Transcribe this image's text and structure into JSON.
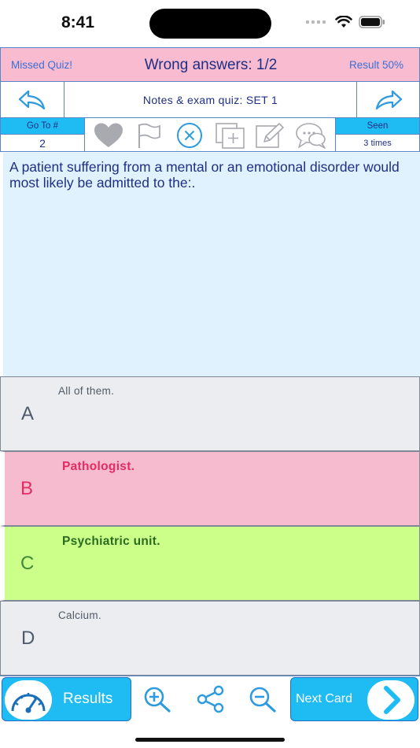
{
  "status_bar": {
    "time": "8:41"
  },
  "header": {
    "missed_quiz": "Missed Quiz!",
    "wrong_answers": "Wrong answers: 1/2",
    "result": "Result 50%"
  },
  "nav": {
    "title": "Notes & exam quiz: SET 1"
  },
  "tools": {
    "goto_label": "Go To #",
    "goto_value": "2",
    "seen_label": "Seen",
    "seen_value": "3 times",
    "icons": [
      "heart-icon",
      "flag-icon",
      "close-circle-icon",
      "add-copy-icon",
      "edit-icon",
      "chat-icon"
    ]
  },
  "question": {
    "text": "A patient suffering from a mental or an emotional disorder would most likely be admitted to the:."
  },
  "answers": [
    {
      "letter": "A",
      "text": "All of them.",
      "state": "neutral"
    },
    {
      "letter": "B",
      "text": "Pathologist.",
      "state": "wrong"
    },
    {
      "letter": "C",
      "text": "Psychiatric unit.",
      "state": "correct"
    },
    {
      "letter": "D",
      "text": "Calcium.",
      "state": "neutral"
    }
  ],
  "bottom": {
    "results_label": "Results",
    "next_label": "Next Card",
    "icons": [
      "zoom-in-icon",
      "share-icon",
      "zoom-out-icon"
    ]
  },
  "colors": {
    "accent": "#1ebcf3",
    "header_pink": "#f8bbcf",
    "correct_green": "#cbff8a",
    "wrong_pink": "#f7bbcf",
    "question_bg": "#dff2fd"
  }
}
